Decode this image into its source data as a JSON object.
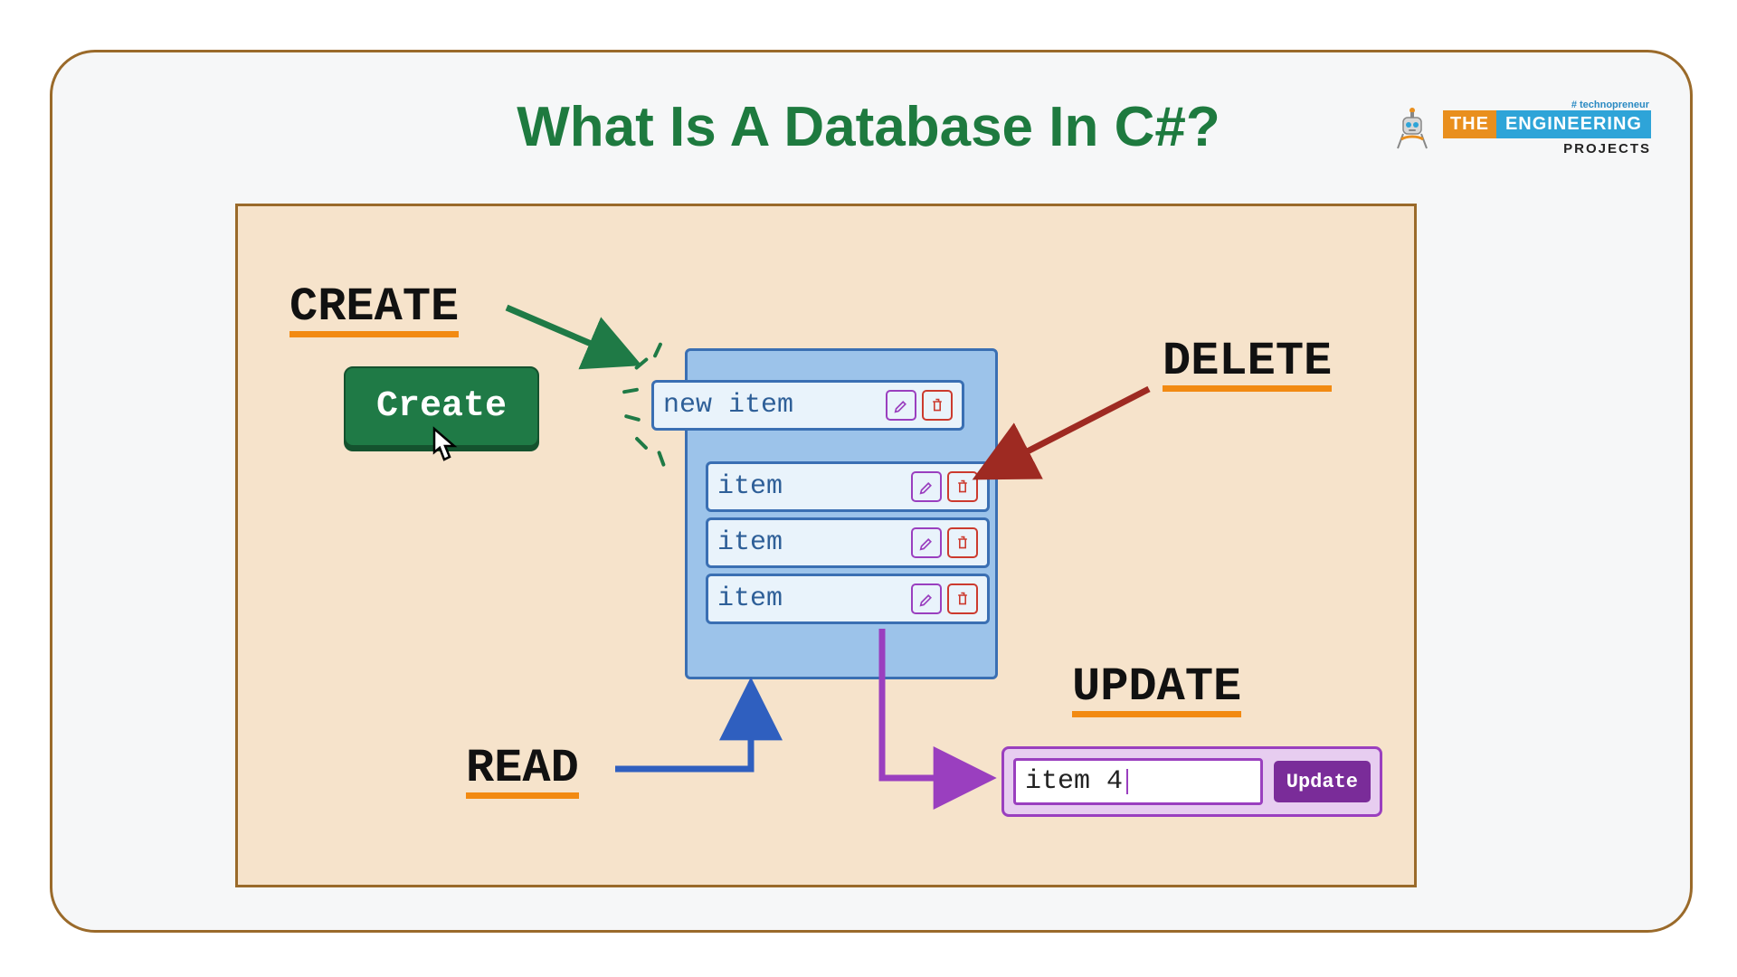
{
  "title": "What Is A Database In C#?",
  "brand": {
    "tag": "# technopreneur",
    "the": "THE",
    "eng": "ENGINEERING",
    "projects": "PROJECTS"
  },
  "labels": {
    "create": "CREATE",
    "delete": "DELETE",
    "read": "READ",
    "update": "UPDATE"
  },
  "createButton": "Create",
  "rows": {
    "new": "new item",
    "r1": "item",
    "r2": "item",
    "r3": "item"
  },
  "updateBox": {
    "input": "item 4",
    "button": "Update"
  },
  "colors": {
    "border": "#9a6a2a",
    "panel": "#f6e3cb",
    "titleGreen": "#1e7a3f",
    "orange": "#f28a12",
    "green": "#1f7a46",
    "blue": "#3a6fb3",
    "purple": "#9a3fbf",
    "red": "#cc3a2e",
    "darkred": "#9e2a22"
  }
}
